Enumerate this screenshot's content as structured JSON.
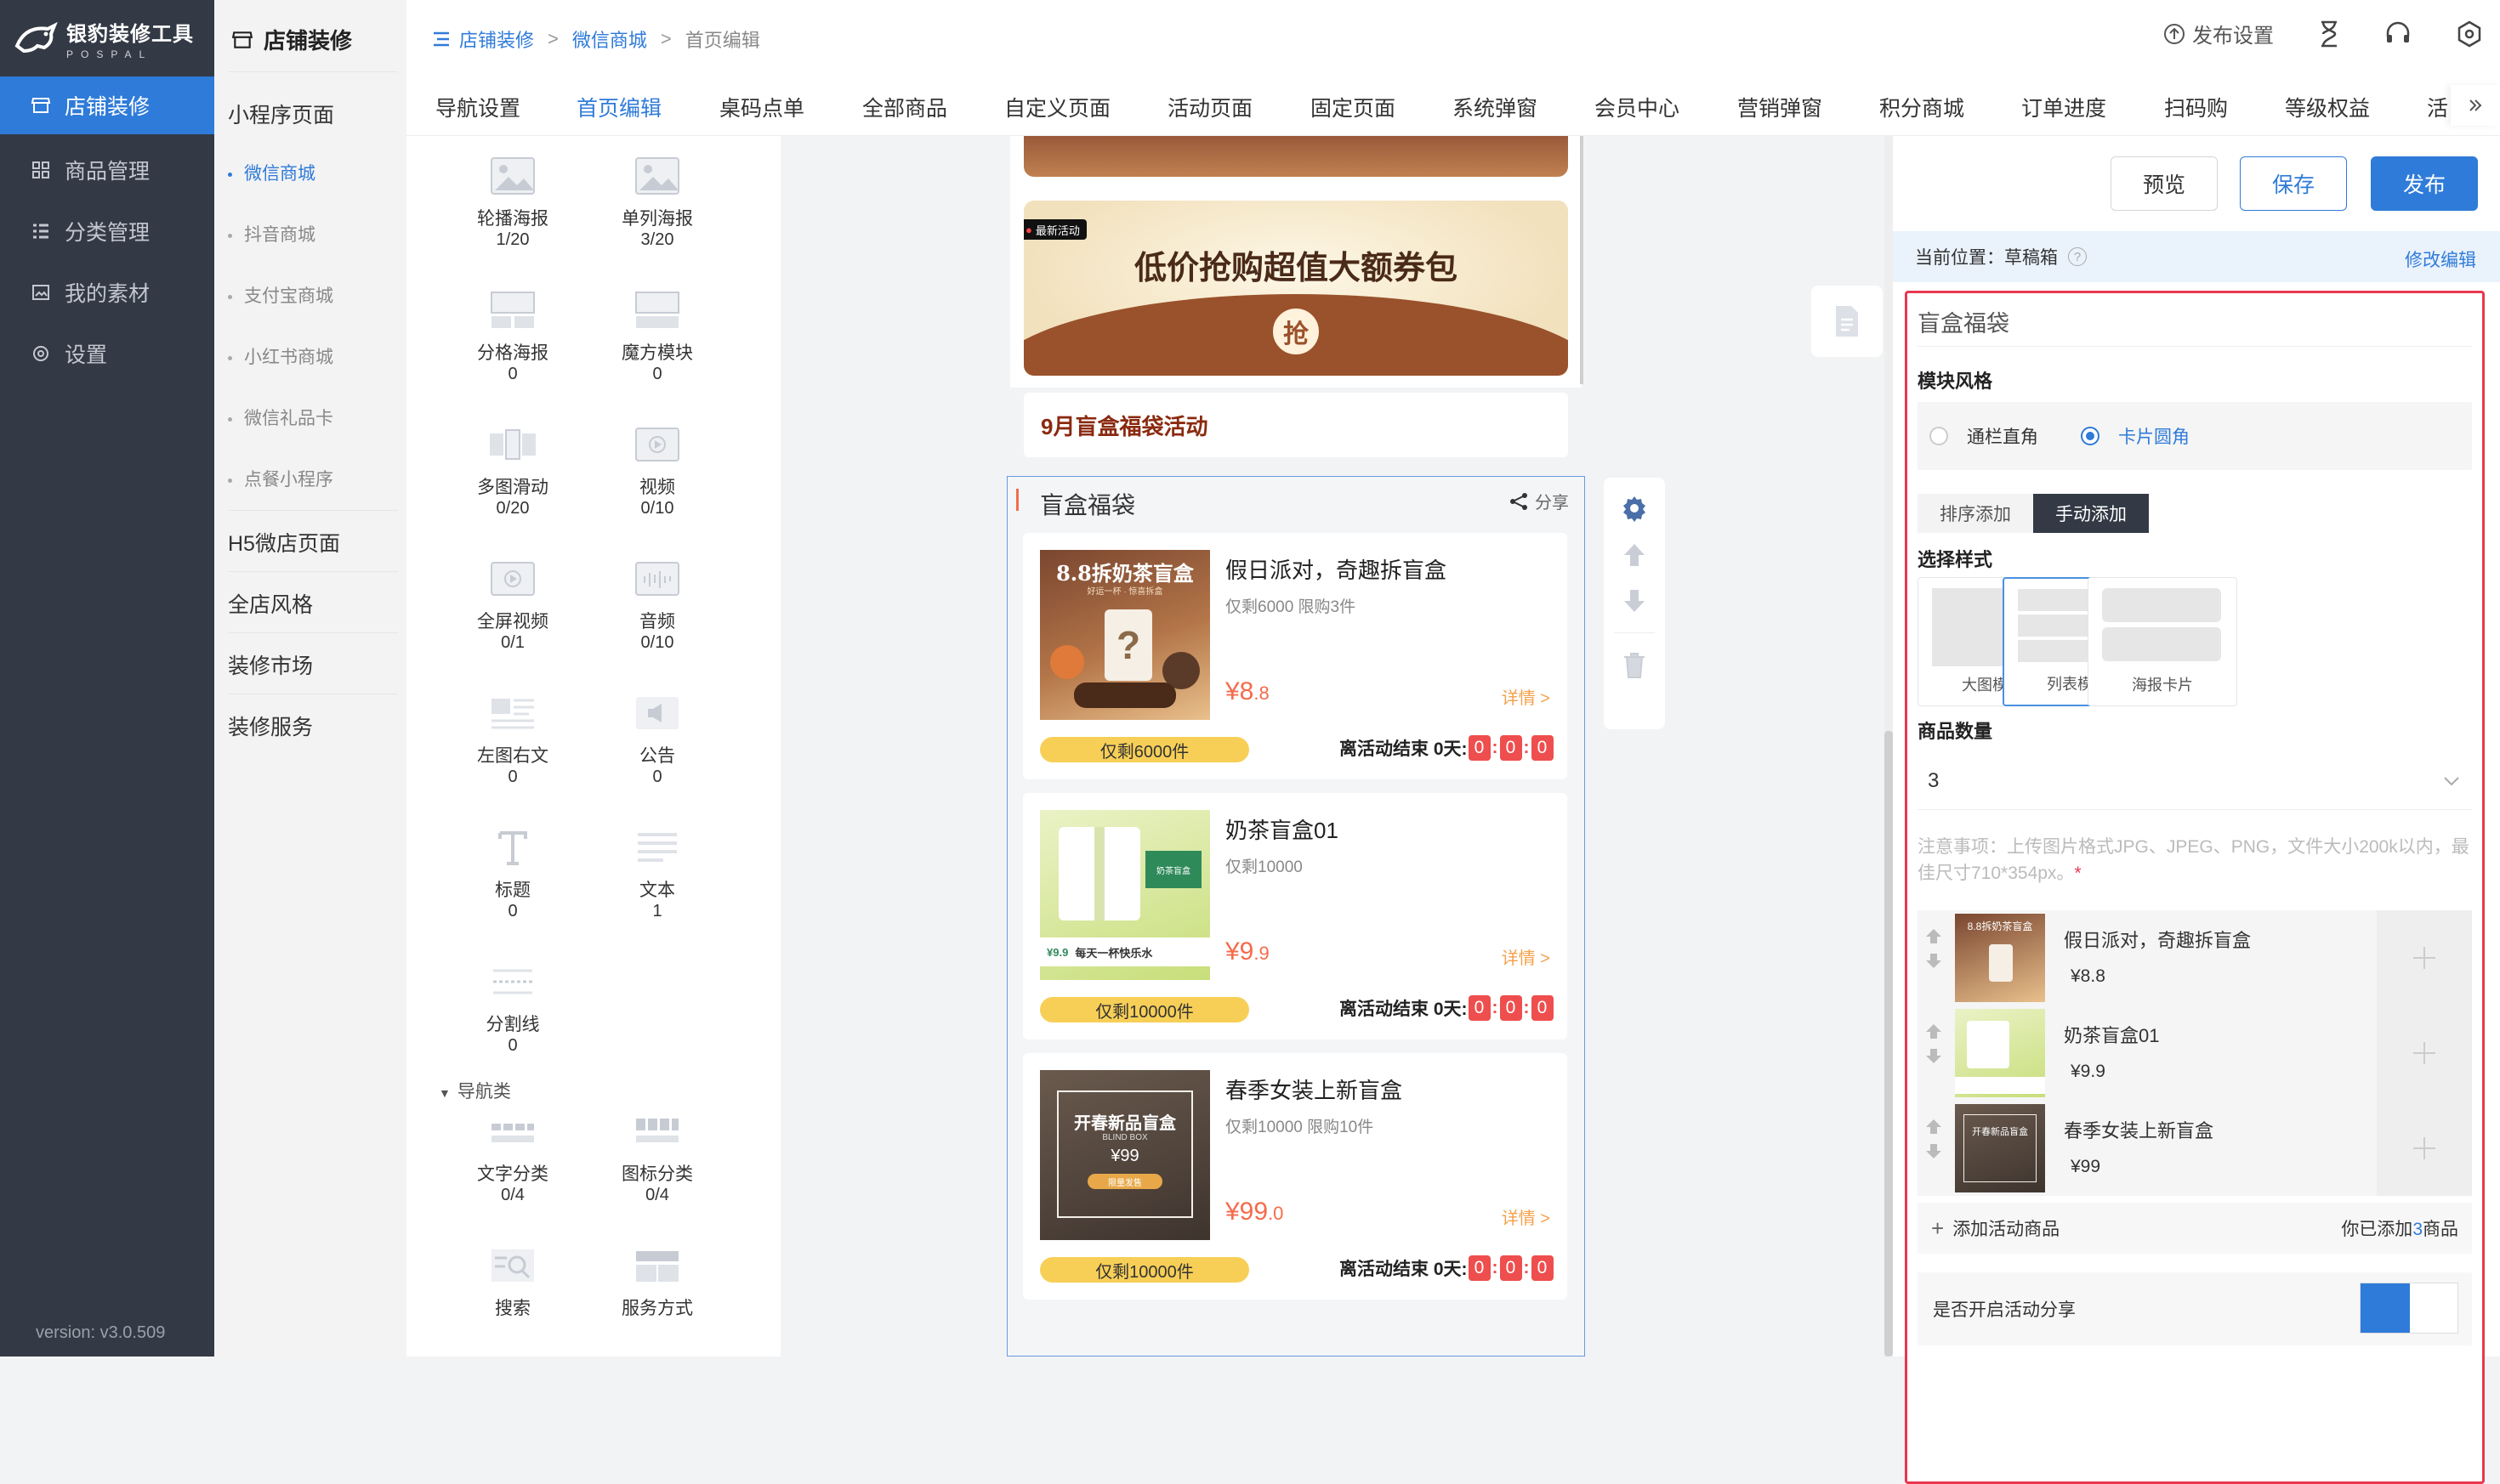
{
  "brand": {
    "name": "银豹装修工具",
    "sub": "POSPAL"
  },
  "version": "version: v3.0.509",
  "sidebar": {
    "items": [
      {
        "label": "店铺装修",
        "icon": "store-icon"
      },
      {
        "label": "商品管理",
        "icon": "grid-icon"
      },
      {
        "label": "分类管理",
        "icon": "list-icon"
      },
      {
        "label": "我的素材",
        "icon": "image-icon"
      },
      {
        "label": "设置",
        "icon": "gear-icon"
      }
    ]
  },
  "subnav": {
    "header": "店铺装修",
    "group1": "小程序页面",
    "items": [
      "微信商城",
      "抖音商城",
      "支付宝商城",
      "小红书商城",
      "微信礼品卡",
      "点餐小程序"
    ],
    "groups": [
      "H5微店页面",
      "全店风格",
      "装修市场",
      "装修服务"
    ]
  },
  "breadcrumb": {
    "items": [
      "店铺装修",
      "微信商城",
      "首页编辑"
    ],
    "sep": ">"
  },
  "top_actions": {
    "publish_settings": "发布设置"
  },
  "tabs": [
    "导航设置",
    "首页编辑",
    "桌码点单",
    "全部商品",
    "自定义页面",
    "活动页面",
    "固定页面",
    "系统弹窗",
    "会员中心",
    "营销弹窗",
    "积分商城",
    "订单进度",
    "扫码购",
    "等级权益",
    "活"
  ],
  "widgets": [
    {
      "name": "轮播海报",
      "count": "1/20"
    },
    {
      "name": "单列海报",
      "count": "3/20"
    },
    {
      "name": "分格海报",
      "count": "0"
    },
    {
      "name": "魔方模块",
      "count": "0"
    },
    {
      "name": "多图滑动",
      "count": "0/20"
    },
    {
      "name": "视频",
      "count": "0/10"
    },
    {
      "name": "全屏视频",
      "count": "0/1"
    },
    {
      "name": "音频",
      "count": "0/10"
    },
    {
      "name": "左图右文",
      "count": "0"
    },
    {
      "name": "公告",
      "count": "0"
    },
    {
      "name": "标题",
      "count": "0"
    },
    {
      "name": "文本",
      "count": "1"
    },
    {
      "name": "分割线",
      "count": "0"
    }
  ],
  "nav_group": {
    "label": "导航类",
    "widgets": [
      {
        "name": "文字分类",
        "count": "0/4"
      },
      {
        "name": "图标分类",
        "count": "0/4"
      },
      {
        "name": "搜索",
        "count": ""
      },
      {
        "name": "服务方式",
        "count": ""
      }
    ]
  },
  "preview": {
    "banner_tag": "最新活动",
    "banner_title": "低价抢购超值大额券包",
    "banner_stamp": "抢",
    "activity_title": "9月盲盒福袋活动",
    "blindbox_title": "盲盒福袋",
    "share": "分享",
    "products": [
      {
        "title": "假日派对，奇趣拆盲盒",
        "sub": "仅剩6000 限购3件",
        "price_int": "¥8",
        "price_dec": ".8",
        "detail": "详情 >",
        "badge": "仅剩6000件",
        "countdown_label": "离活动结束 0天:",
        "digits": [
          "0",
          "0",
          "0"
        ],
        "img_text": "8.8拆奶茶盲盒",
        "img_sub": "好运一杯 · 惊喜拆盒"
      },
      {
        "title": "奶茶盲盒01",
        "sub": "仅剩10000",
        "price_int": "¥9",
        "price_dec": ".9",
        "detail": "详情 >",
        "badge": "仅剩10000件",
        "countdown_label": "离活动结束 0天:",
        "digits": [
          "0",
          "0",
          "0"
        ],
        "img_text": "每天一杯快乐水",
        "img_sub": "¥9.9",
        "img_tag": "奶茶盲盒"
      },
      {
        "title": "春季女装上新盲盒",
        "sub": "仅剩10000 限购10件",
        "price_int": "¥99",
        "price_dec": ".0",
        "detail": "详情 >",
        "badge": "仅剩10000件",
        "countdown_label": "离活动结束 0天:",
        "digits": [
          "0",
          "0",
          "0"
        ],
        "img_text": "开春新品盲盒",
        "img_sub": "BLIND BOX",
        "img_price": "¥99",
        "img_tag": "限量发售"
      }
    ]
  },
  "panel": {
    "preview_btn": "预览",
    "save_btn": "保存",
    "publish_btn": "发布",
    "location_label": "当前位置：草稿箱",
    "edit_link": "修改编辑",
    "module_title": "盲盒福袋",
    "style_label": "模块风格",
    "radio1": "通栏直角",
    "radio2": "卡片圆角",
    "seg1": "排序添加",
    "seg2": "手动添加",
    "choose_style": "选择样式",
    "styles": [
      "大图模式",
      "列表模式",
      "海报卡片"
    ],
    "qty_label": "商品数量",
    "qty_value": "3",
    "note": "注意事项：上传图片格式JPG、JPEG、PNG，文件大小200k以内，最佳尺寸710*354px。",
    "note_star": "*",
    "rows": [
      {
        "name": "假日派对，奇趣拆盲盒",
        "price": "¥8.8"
      },
      {
        "name": "奶茶盲盒01",
        "price": "¥9.9"
      },
      {
        "name": "春季女装上新盲盒",
        "price": "¥99"
      }
    ],
    "add_label": "添加活动商品",
    "added_prefix": "你已添加",
    "added_count": "3",
    "added_suffix": "商品",
    "share_label": "是否开启活动分享"
  },
  "colors": {
    "accent": "#2f7bd9",
    "sidebar": "#333a45",
    "price": "#f56b4b",
    "highlight": "#e8384f"
  }
}
